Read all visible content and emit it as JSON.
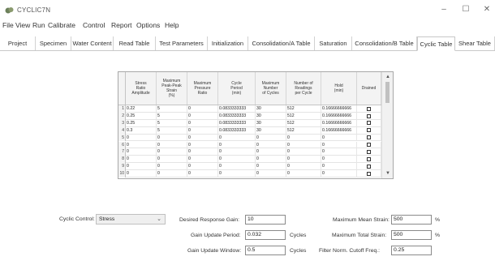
{
  "window": {
    "title": "CYCLIC7N",
    "controls": {
      "minimize": "–",
      "maximize": "☐",
      "close": "✕"
    }
  },
  "menu": [
    "File",
    "View",
    "Run",
    "Calibrate",
    "Control",
    "Report",
    "Options",
    "Help"
  ],
  "tabs": [
    {
      "label": "Project",
      "active": false
    },
    {
      "label": "Specimen",
      "active": false
    },
    {
      "label": "Water Content",
      "active": false
    },
    {
      "label": "Read Table",
      "active": false
    },
    {
      "label": "Test Parameters",
      "active": false
    },
    {
      "label": "Initialization",
      "active": false
    },
    {
      "label": "Consolidation/A Table",
      "active": false
    },
    {
      "label": "Saturation",
      "active": false
    },
    {
      "label": "Consolidation/B Table",
      "active": false
    },
    {
      "label": "Cyclic Table",
      "active": true
    },
    {
      "label": "Shear Table",
      "active": false
    }
  ],
  "table": {
    "columns": [
      "Stress\nRatio\nAmplitude",
      "Maximum\nPeak-Peak\nStrain\n(%)",
      "Maximum\nPressure\nRatio",
      "Cycle\nPeriod\n(min)",
      "Maximum\nNumber\nof Cycles",
      "Number of\nReadings\nper Cycle",
      "Hold\n(min)",
      "Drained"
    ],
    "rows": [
      {
        "n": "1",
        "cells": [
          "0.22",
          "5",
          "0",
          "0.0833333333",
          "30",
          "512",
          "0.16666666666"
        ],
        "drained": false
      },
      {
        "n": "2",
        "cells": [
          "0.25",
          "5",
          "0",
          "0.0833333333",
          "30",
          "512",
          "0.16666666666"
        ],
        "drained": false
      },
      {
        "n": "3",
        "cells": [
          "0.25",
          "5",
          "0",
          "0.0833333333",
          "30",
          "512",
          "0.16666666666"
        ],
        "drained": false
      },
      {
        "n": "4",
        "cells": [
          "0.3",
          "5",
          "0",
          "0.0833333333",
          "30",
          "512",
          "0.16666666666"
        ],
        "drained": false
      },
      {
        "n": "5",
        "cells": [
          "0",
          "0",
          "0",
          "0",
          "0",
          "0",
          "0"
        ],
        "drained": false
      },
      {
        "n": "6",
        "cells": [
          "0",
          "0",
          "0",
          "0",
          "0",
          "0",
          "0"
        ],
        "drained": false
      },
      {
        "n": "7",
        "cells": [
          "0",
          "0",
          "0",
          "0",
          "0",
          "0",
          "0"
        ],
        "drained": false
      },
      {
        "n": "8",
        "cells": [
          "0",
          "0",
          "0",
          "0",
          "0",
          "0",
          "0"
        ],
        "drained": false
      },
      {
        "n": "9",
        "cells": [
          "0",
          "0",
          "0",
          "0",
          "0",
          "0",
          "0"
        ],
        "drained": false
      },
      {
        "n": "10",
        "cells": [
          "0",
          "0",
          "0",
          "0",
          "0",
          "0",
          "0"
        ],
        "drained": false
      }
    ]
  },
  "controls": {
    "cyclic_control_label": "Cyclic Control:",
    "cyclic_control_value": "Stress",
    "desired_gain_label": "Desired Response Gain:",
    "desired_gain_value": "10",
    "gain_period_label": "Gain Update Period:",
    "gain_period_value": "0.032",
    "gain_period_unit": "Cycles",
    "gain_window_label": "Gain Update Window:",
    "gain_window_value": "0.5",
    "gain_window_unit": "Cycles",
    "max_mean_strain_label": "Maximum Mean Strain:",
    "max_mean_strain_value": "500",
    "max_mean_strain_unit": "%",
    "max_total_strain_label": "Maximum Total Strain:",
    "max_total_strain_value": "500",
    "max_total_strain_unit": "%",
    "filter_label": "Filter Norm. Cutoff Freq.:",
    "filter_value": "0.25"
  }
}
